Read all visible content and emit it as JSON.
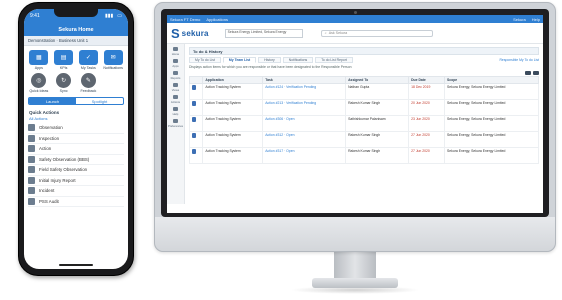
{
  "colors": {
    "accent": "#2f7fd2",
    "brand": "#1f5fa8",
    "overdue": "#c0392b"
  },
  "desktop": {
    "topbar": {
      "left": "Sekura FT Demo",
      "apps": "Applications",
      "user": "Sekura",
      "help": "Help"
    },
    "logo": {
      "mark": "S",
      "name": "sekura"
    },
    "org_selector": "Sekura Energy Limited, Sekura Energy",
    "search_placeholder": "Ask Sekura",
    "nav": [
      {
        "label": "Home",
        "icon": "home-icon"
      },
      {
        "label": "Apps",
        "icon": "apps-icon"
      },
      {
        "label": "Reports",
        "icon": "reports-icon"
      },
      {
        "label": "Views",
        "icon": "views-icon"
      },
      {
        "label": "Actions",
        "icon": "actions-icon"
      },
      {
        "label": "Help",
        "icon": "help-icon"
      },
      {
        "label": "Preferences",
        "icon": "preferences-icon"
      }
    ],
    "widget_title": "To do & History",
    "tabs": [
      "My To do List",
      "My Team List",
      "History",
      "Notifications",
      "To do List Report"
    ],
    "active_tab": 1,
    "tabs_right": "Responsible My To do List",
    "note": "Displays action items for which you are responsible or that have been designated to the Responsible Person",
    "columns": [
      "Application",
      "Task",
      "Assigned To",
      "Due Date",
      "Scope"
    ],
    "rows": [
      {
        "application": "Action Tracking System",
        "task": "Action #124 · Verification Pending",
        "assigned": "Nathan Gupta",
        "due": "18 Dec 2019",
        "scope": "Sekura Energy, Sekura Energy Limited"
      },
      {
        "application": "Action Tracking System",
        "task": "Action #213 · Verification Pending",
        "assigned": "Rakesh Kumar Singh",
        "due": "20 Jun 2020",
        "scope": "Sekura Energy, Sekura Energy Limited"
      },
      {
        "application": "Action Tracking System",
        "task": "Action #306 · Open",
        "assigned": "Sathishkumar Palanisam",
        "due": "23 Jun 2020",
        "scope": "Sekura Energy, Sekura Energy Limited"
      },
      {
        "application": "Action Tracking System",
        "task": "Action #312 · Open",
        "assigned": "Rakesh Kumar Singh",
        "due": "27 Jun 2020",
        "scope": "Sekura Energy, Sekura Energy Limited"
      },
      {
        "application": "Action Tracking System",
        "task": "Action #317 · Open",
        "assigned": "Rakesh Kumar Singh",
        "due": "27 Jun 2020",
        "scope": "Sekura Energy, Sekura Energy Limited"
      }
    ]
  },
  "phone": {
    "time": "9:41",
    "title": "Sekura Home",
    "org": "Demonstration · Business Unit 1",
    "grid": [
      {
        "label": "Apps",
        "icon": "apps-icon",
        "glyph": "▦"
      },
      {
        "label": "KPIs",
        "icon": "kpi-icon",
        "glyph": "▤"
      },
      {
        "label": "My Tasks",
        "icon": "tasks-icon",
        "glyph": "✓"
      },
      {
        "label": "Notifications",
        "icon": "bell-icon",
        "glyph": "✉"
      },
      {
        "label": "Quick Ideas",
        "icon": "idea-icon",
        "glyph": "◎"
      },
      {
        "label": "Sync",
        "icon": "sync-icon",
        "glyph": "↻"
      },
      {
        "label": "Feedback",
        "icon": "feedback-icon",
        "glyph": "✎"
      }
    ],
    "segments": [
      "Launch",
      "Spotlight"
    ],
    "section": "Quick Actions",
    "subsection": "All Actions",
    "list": [
      "Observation",
      "Inspection",
      "Action",
      "Safety Observation (BBS)",
      "Field Safety Observation",
      "Initial Injury Report",
      "Incident",
      "PSS Audit"
    ]
  }
}
